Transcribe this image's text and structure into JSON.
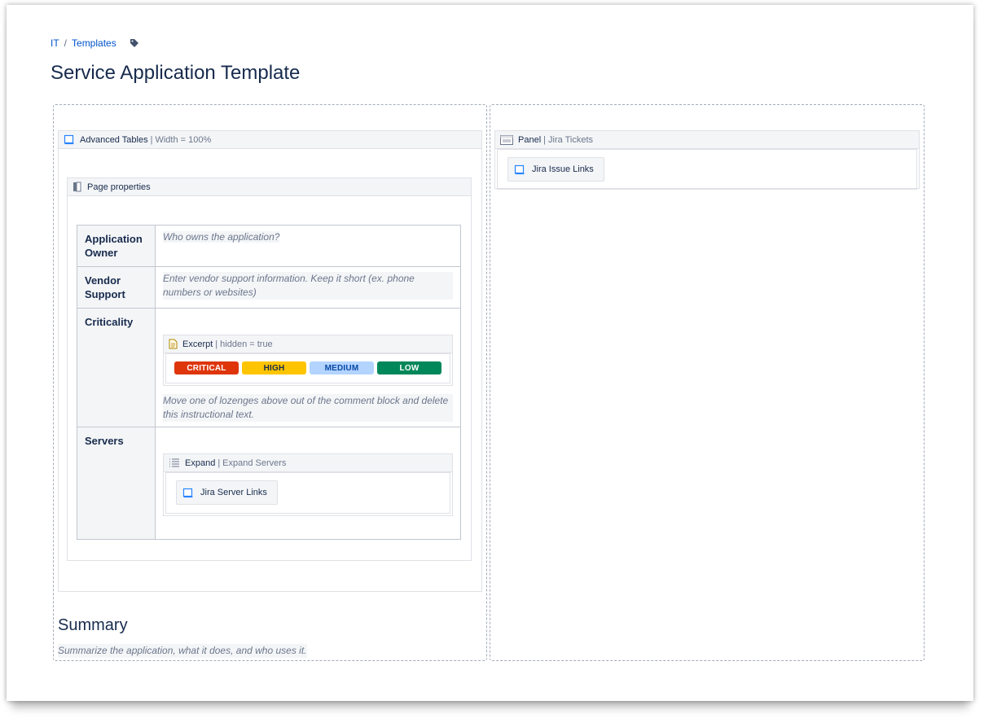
{
  "breadcrumb": {
    "items": [
      "IT",
      "Templates"
    ],
    "separator": "/",
    "tag_icon": "tag-icon"
  },
  "page": {
    "title": "Service Application Template"
  },
  "advanced_tables": {
    "name": "Advanced Tables",
    "params": "Width = 100%"
  },
  "page_properties": {
    "name": "Page properties",
    "rows": [
      {
        "label": "Application Owner",
        "placeholder": "Who owns the application?"
      },
      {
        "label": "Vendor Support",
        "placeholder": "Enter vendor support information. Keep it short (ex. phone numbers or websites)"
      },
      {
        "label": "Criticality"
      },
      {
        "label": "Servers"
      }
    ]
  },
  "excerpt": {
    "name": "Excerpt",
    "params": "hidden = true",
    "lozenges": [
      {
        "label": "CRITICAL",
        "bg": "#de350b",
        "fg": "#ffffff"
      },
      {
        "label": "HIGH",
        "bg": "#ffc400",
        "fg": "#172b4d"
      },
      {
        "label": "MEDIUM",
        "bg": "#b3d4ff",
        "fg": "#0747a6"
      },
      {
        "label": "LOW",
        "bg": "#00875a",
        "fg": "#ffffff"
      }
    ],
    "instruction": "Move one of lozenges above out of the comment block and delete this instructional text."
  },
  "expand": {
    "name": "Expand",
    "params": "Expand Servers",
    "button": "Jira Server Links"
  },
  "summary": {
    "title": "Summary",
    "placeholder": "Summarize the application, what it does, and who uses it."
  },
  "panel": {
    "name": "Panel",
    "params": "Jira Tickets",
    "button": "Jira Issue Links"
  },
  "colors": {
    "link": "#0052cc",
    "text": "#172b4d",
    "muted": "#6b778c",
    "border": "#dfe1e6"
  }
}
